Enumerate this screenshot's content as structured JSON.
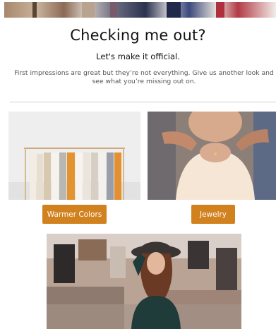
{
  "header": {
    "title": "Checking me out?",
    "subtitle": "Let's make it official.",
    "body": "First impressions are great but they’re not everything. Give us another look and see what you’re missing out on."
  },
  "categories": [
    {
      "label": "Warmer Colors"
    },
    {
      "label": "Jewelry"
    }
  ],
  "colors": {
    "button": "#d2811f",
    "divider": "#cfcfcf"
  }
}
